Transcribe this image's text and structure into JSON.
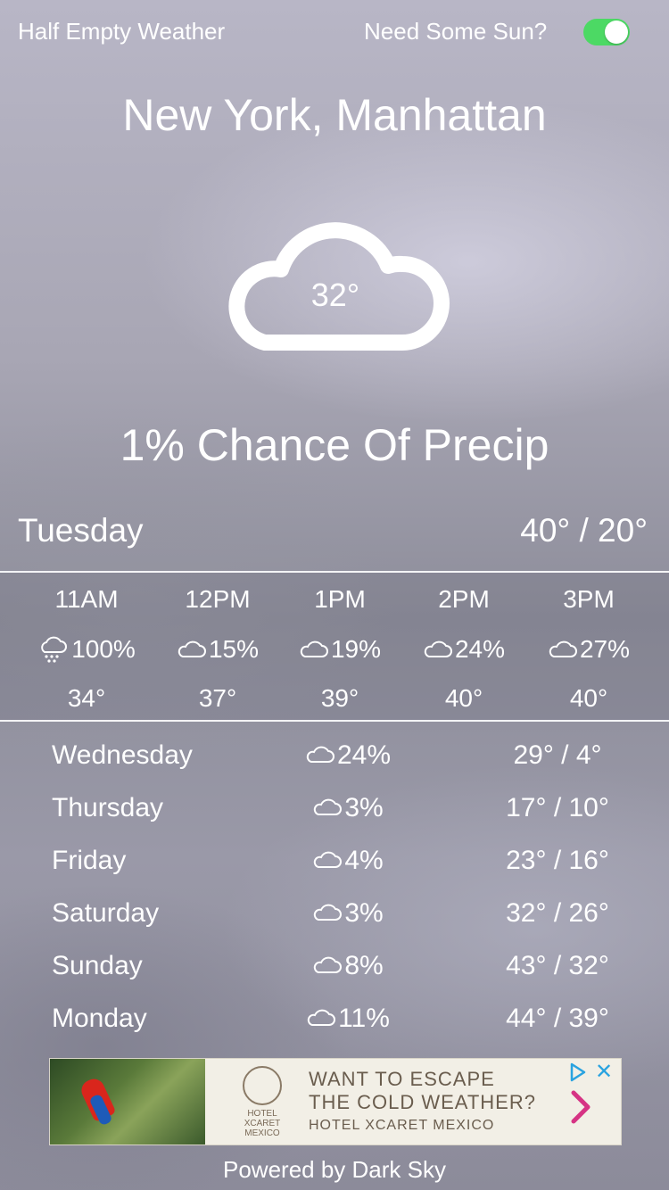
{
  "header": {
    "app_title": "Half Empty Weather",
    "sun_toggle_label": "Need Some Sun?",
    "sun_toggle_on": true,
    "toggle_color": "#4cd964"
  },
  "location": "New York, Manhattan",
  "current": {
    "icon": "cloud-icon",
    "temperature": "32°",
    "precip_text": "1% Chance Of Precip"
  },
  "today": {
    "day": "Tuesday",
    "range": "40° / 20°"
  },
  "hourly": [
    {
      "time": "11AM",
      "icon": "snow-cloud-icon",
      "precip": "100%",
      "temp": "34°"
    },
    {
      "time": "12PM",
      "icon": "cloud-icon",
      "precip": "15%",
      "temp": "37°"
    },
    {
      "time": "1PM",
      "icon": "cloud-icon",
      "precip": "19%",
      "temp": "39°"
    },
    {
      "time": "2PM",
      "icon": "cloud-icon",
      "precip": "24%",
      "temp": "40°"
    },
    {
      "time": "3PM",
      "icon": "cloud-icon",
      "precip": "27%",
      "temp": "40°"
    }
  ],
  "daily": [
    {
      "day": "Wednesday",
      "icon": "cloud-icon",
      "precip": "24%",
      "range": "29° / 4°"
    },
    {
      "day": "Thursday",
      "icon": "cloud-icon",
      "precip": "3%",
      "range": "17° / 10°"
    },
    {
      "day": "Friday",
      "icon": "cloud-icon",
      "precip": "4%",
      "range": "23° / 16°"
    },
    {
      "day": "Saturday",
      "icon": "cloud-icon",
      "precip": "3%",
      "range": "32° / 26°"
    },
    {
      "day": "Sunday",
      "icon": "cloud-icon",
      "precip": "8%",
      "range": "43° / 32°"
    },
    {
      "day": "Monday",
      "icon": "cloud-icon",
      "precip": "11%",
      "range": "44° / 39°"
    }
  ],
  "ad": {
    "line1": "WANT TO ESCAPE",
    "line2": "THE COLD WEATHER?",
    "line3": "HOTEL XCARET MEXICO",
    "logo_text": "HOTEL XCARET MEXICO",
    "close_label": "✕",
    "accent_color": "#d63384"
  },
  "footer": {
    "powered_by": "Powered by Dark Sky"
  }
}
